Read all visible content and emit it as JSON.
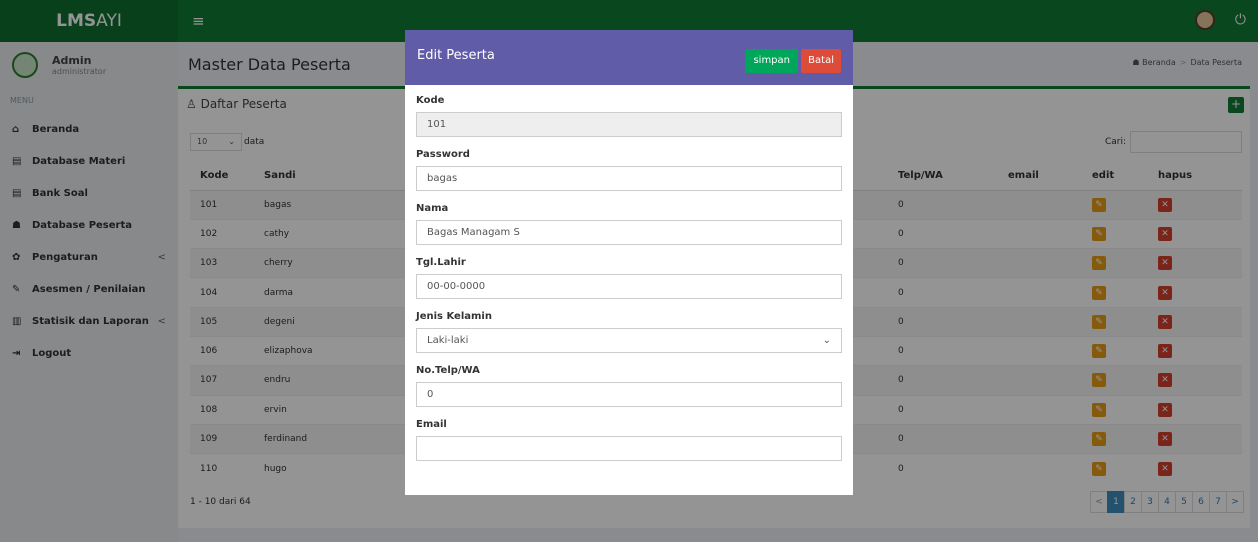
{
  "app": {
    "logo_bold": "LMS",
    "logo_light": " AYI"
  },
  "icons": {
    "menu": "hamburger-icon",
    "power": "power-icon"
  },
  "user": {
    "name": "Admin",
    "role": "administrator"
  },
  "sidebar": {
    "header": "MENU",
    "items": [
      {
        "icon": "⌂",
        "label": "Beranda",
        "chev": ""
      },
      {
        "icon": "▤",
        "label": "Database Materi",
        "chev": ""
      },
      {
        "icon": "▤",
        "label": "Bank Soal",
        "chev": ""
      },
      {
        "icon": "☗",
        "label": "Database Peserta",
        "chev": ""
      },
      {
        "icon": "✿",
        "label": "Pengaturan",
        "chev": "<"
      },
      {
        "icon": "✎",
        "label": "Asesmen / Penilaian",
        "chev": ""
      },
      {
        "icon": "▥",
        "label": "Statisik dan Laporan",
        "chev": "<"
      },
      {
        "icon": "⇥",
        "label": "Logout",
        "chev": ""
      }
    ]
  },
  "page": {
    "title": "Master Data Peserta",
    "breadcrumb": [
      "Beranda",
      "Data Peserta"
    ],
    "box_title": "Daftar Peserta",
    "length_value": "10",
    "length_label": "data",
    "search_label": "Cari:",
    "info": "1 - 10 dari 64"
  },
  "table": {
    "columns": [
      "Kode",
      "Sandi",
      "Telp/WA",
      "email",
      "edit",
      "hapus"
    ],
    "rows": [
      [
        "101",
        "bagas",
        "0",
        ""
      ],
      [
        "102",
        "cathy",
        "0",
        ""
      ],
      [
        "103",
        "cherry",
        "0",
        ""
      ],
      [
        "104",
        "darma",
        "0",
        ""
      ],
      [
        "105",
        "degeni",
        "0",
        ""
      ],
      [
        "106",
        "elizaphova",
        "0",
        ""
      ],
      [
        "107",
        "endru",
        "0",
        ""
      ],
      [
        "108",
        "ervin",
        "0",
        ""
      ],
      [
        "109",
        "ferdinand",
        "0",
        ""
      ],
      [
        "110",
        "hugo",
        "0",
        ""
      ]
    ]
  },
  "pagination": [
    "<",
    "1",
    "2",
    "3",
    "4",
    "5",
    "6",
    "7",
    ">"
  ],
  "modal": {
    "title": "Edit Peserta",
    "save": "simpan",
    "cancel": "Batal",
    "fields": {
      "kode": {
        "label": "Kode",
        "value": "101"
      },
      "password": {
        "label": "Password",
        "value": "bagas"
      },
      "nama": {
        "label": "Nama",
        "value": "Bagas Managam S"
      },
      "tgl": {
        "label": "Tgl.Lahir",
        "value": "00-00-0000"
      },
      "jk": {
        "label": "Jenis Kelamin",
        "value": "Laki-laki"
      },
      "telp": {
        "label": "No.Telp/WA",
        "value": "0"
      },
      "email": {
        "label": "Email",
        "value": ""
      }
    }
  }
}
